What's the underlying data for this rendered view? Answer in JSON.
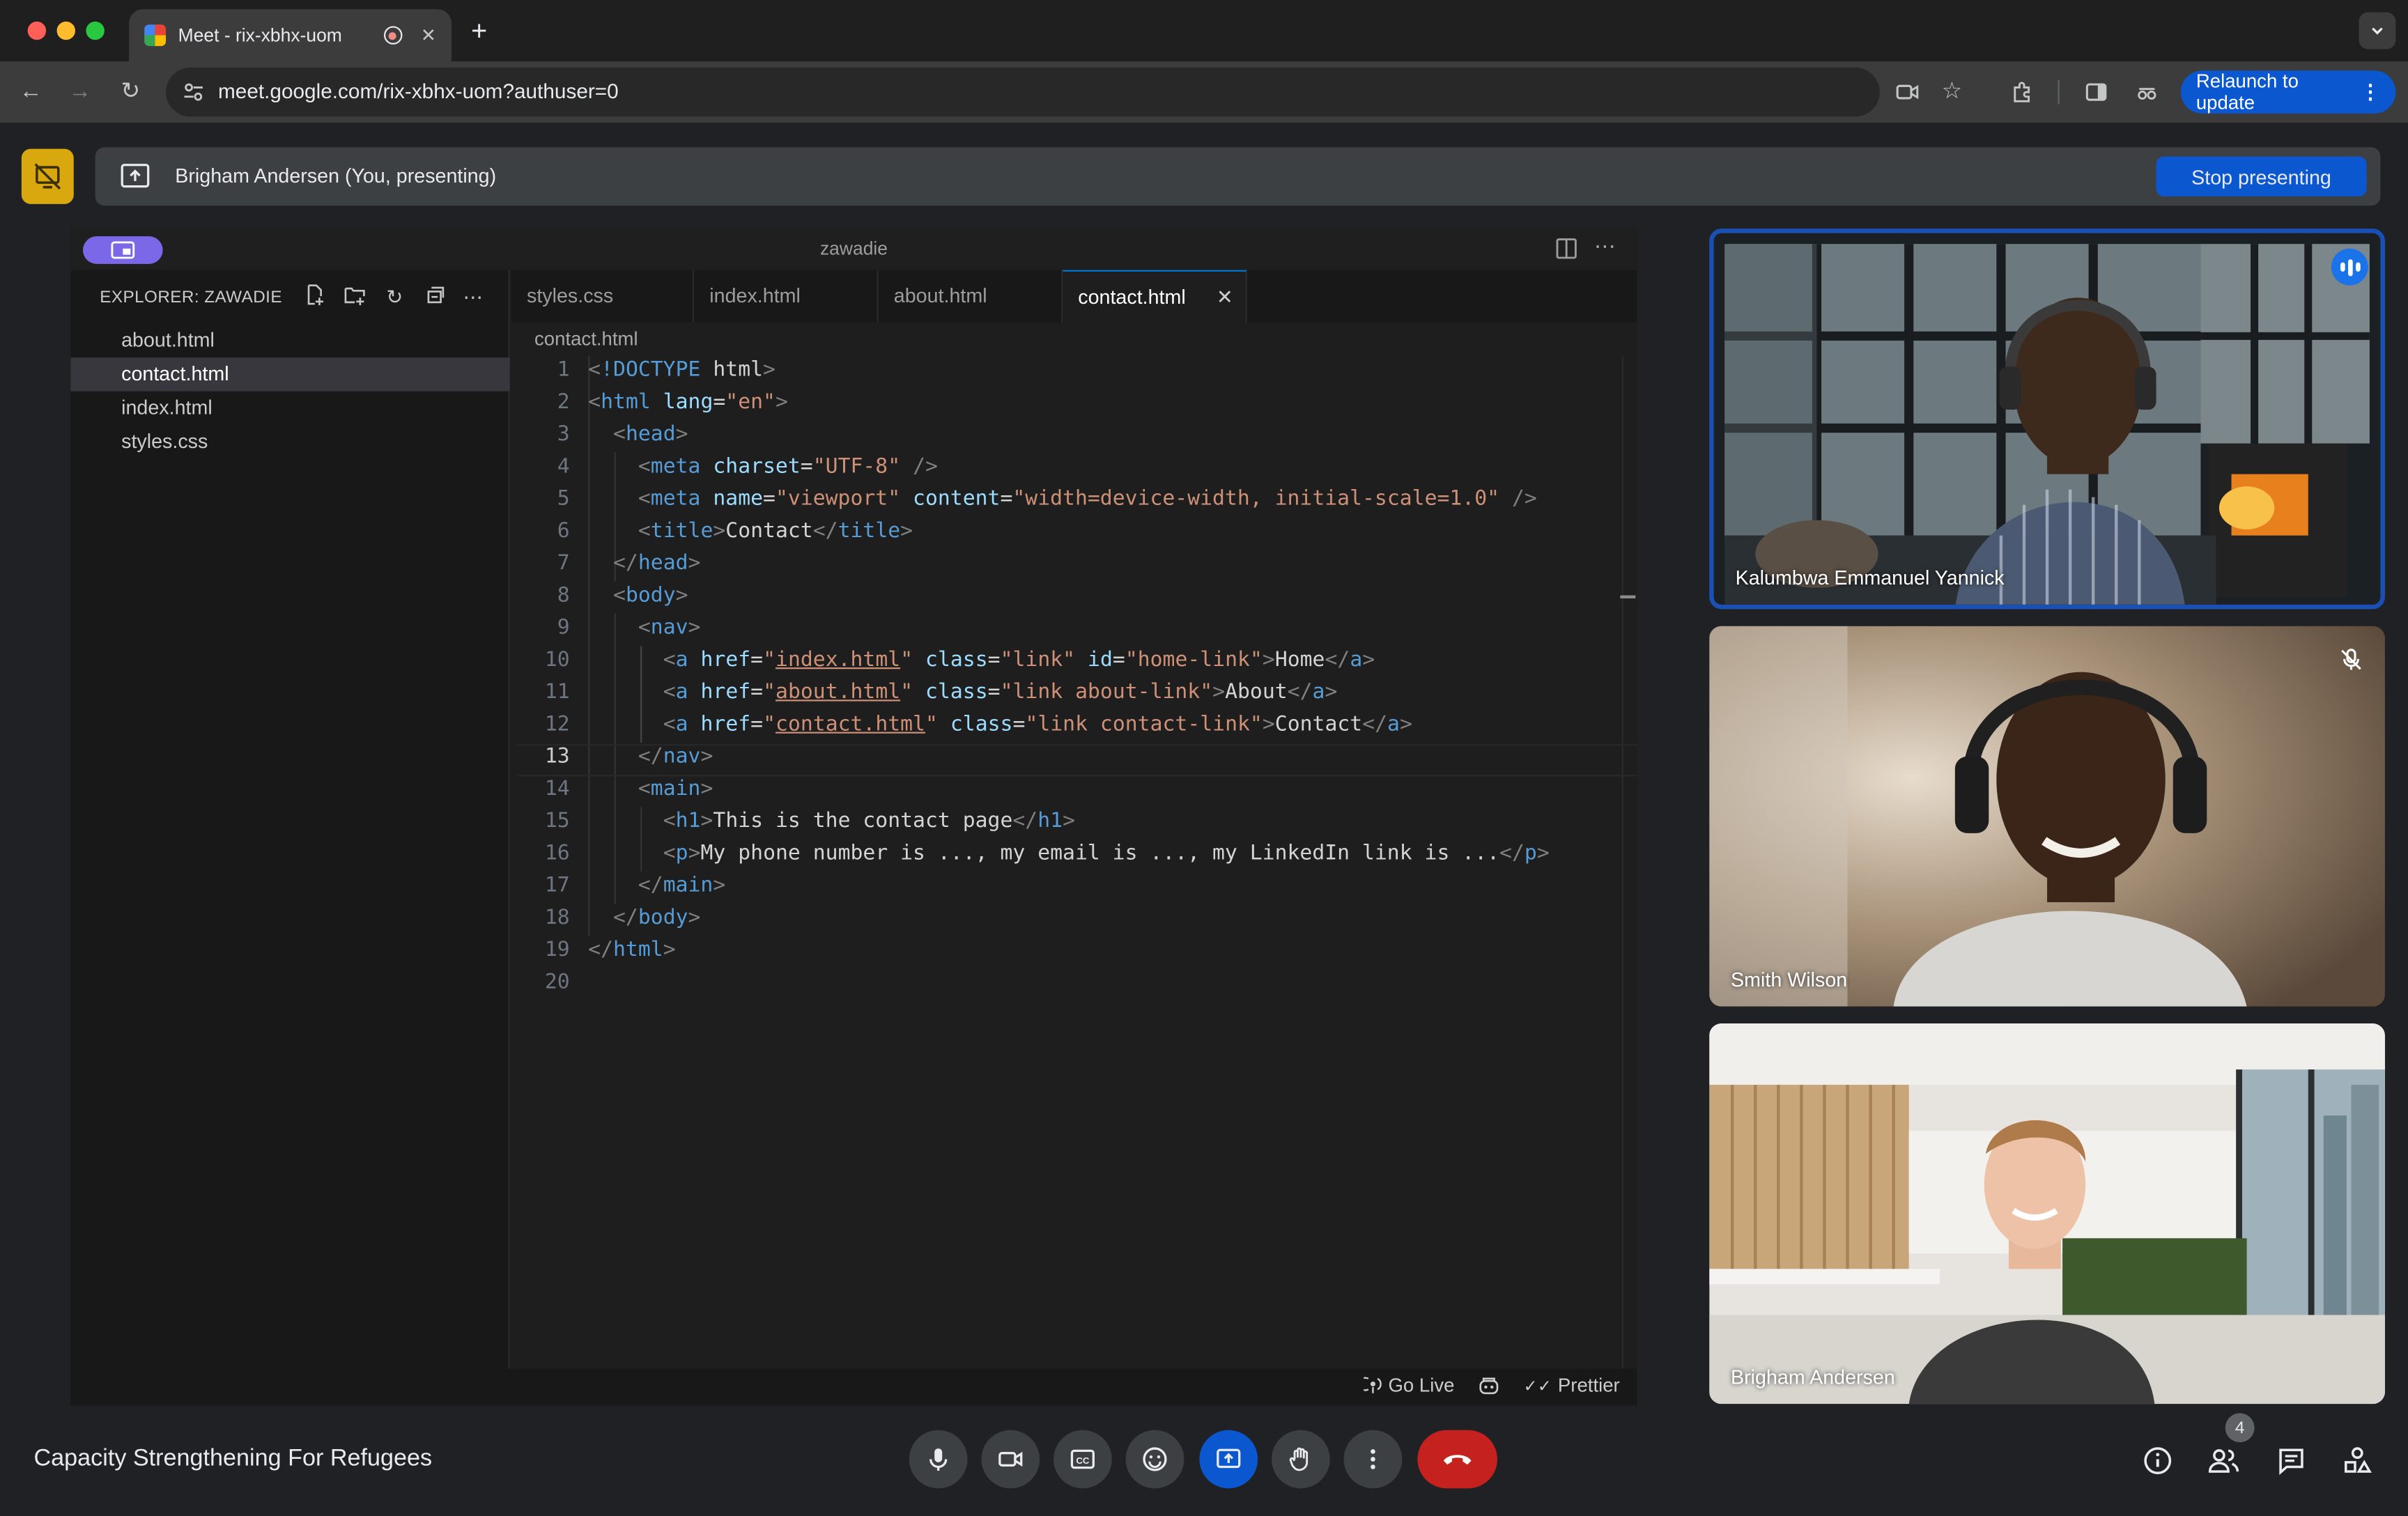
{
  "browser": {
    "tab_title": "Meet - rix-xbhx-uom",
    "new_tab_icon": "plus-icon",
    "url": "meet.google.com/rix-xbhx-uom?authuser=0",
    "relaunch_label": "Relaunch to update",
    "traffic_colors": [
      "#ff5f57",
      "#febc2e",
      "#28c840"
    ]
  },
  "presenting": {
    "label": "Brigham Andersen (You, presenting)",
    "stop_label": "Stop presenting",
    "accent": "#d9a70e"
  },
  "vscode": {
    "window_title": "zawadie",
    "explorer_title": "EXPLORER: ZAWADIE",
    "files": [
      "about.html",
      "contact.html",
      "index.html",
      "styles.css"
    ],
    "active_file": "contact.html",
    "tabs": [
      "styles.css",
      "index.html",
      "about.html",
      "contact.html"
    ],
    "active_tab": "contact.html",
    "breadcrumb": "contact.html",
    "current_line": 13,
    "line_numbers": [
      "1",
      "2",
      "3",
      "4",
      "5",
      "6",
      "7",
      "8",
      "9",
      "10",
      "11",
      "12",
      "13",
      "14",
      "15",
      "16",
      "17",
      "18",
      "19",
      "20"
    ],
    "code_lines": [
      "<!DOCTYPE html>",
      "<html lang=\"en\">",
      "  <head>",
      "    <meta charset=\"UTF-8\" />",
      "    <meta name=\"viewport\" content=\"width=device-width, initial-scale=1.0\" />",
      "    <title>Contact</title>",
      "  </head>",
      "  <body>",
      "    <nav>",
      "      <a href=\"index.html\" class=\"link\" id=\"home-link\">Home</a>",
      "      <a href=\"about.html\" class=\"link about-link\">About</a>",
      "      <a href=\"contact.html\" class=\"link contact-link\">Contact</a>",
      "    </nav>",
      "    <main>",
      "      <h1>This is the contact page</h1>",
      "      <p>My phone number is ..., my email is ..., my LinkedIn link is ...</p>",
      "    </main>",
      "  </body>",
      "</html>",
      ""
    ],
    "status": {
      "go_live": "Go Live",
      "prettier": "Prettier"
    }
  },
  "participants": [
    {
      "name": "Kalumbwa Emmanuel Yannick",
      "speaking": true
    },
    {
      "name": "Smith Wilson",
      "muted": true
    },
    {
      "name": "Brigham Andersen"
    }
  ],
  "meeting": {
    "title": "Capacity Strengthening For Refugees",
    "people_count": "4",
    "controls": [
      "mic-icon",
      "camera-icon",
      "captions-icon",
      "emoji-icon",
      "present-icon",
      "raise-hand-icon",
      "more-options-icon",
      "leave-call-icon"
    ],
    "right_controls": [
      "info-icon",
      "people-icon",
      "chat-icon",
      "activities-icon"
    ],
    "end_call_color": "#c5221f",
    "present_color": "#0b57d0"
  }
}
